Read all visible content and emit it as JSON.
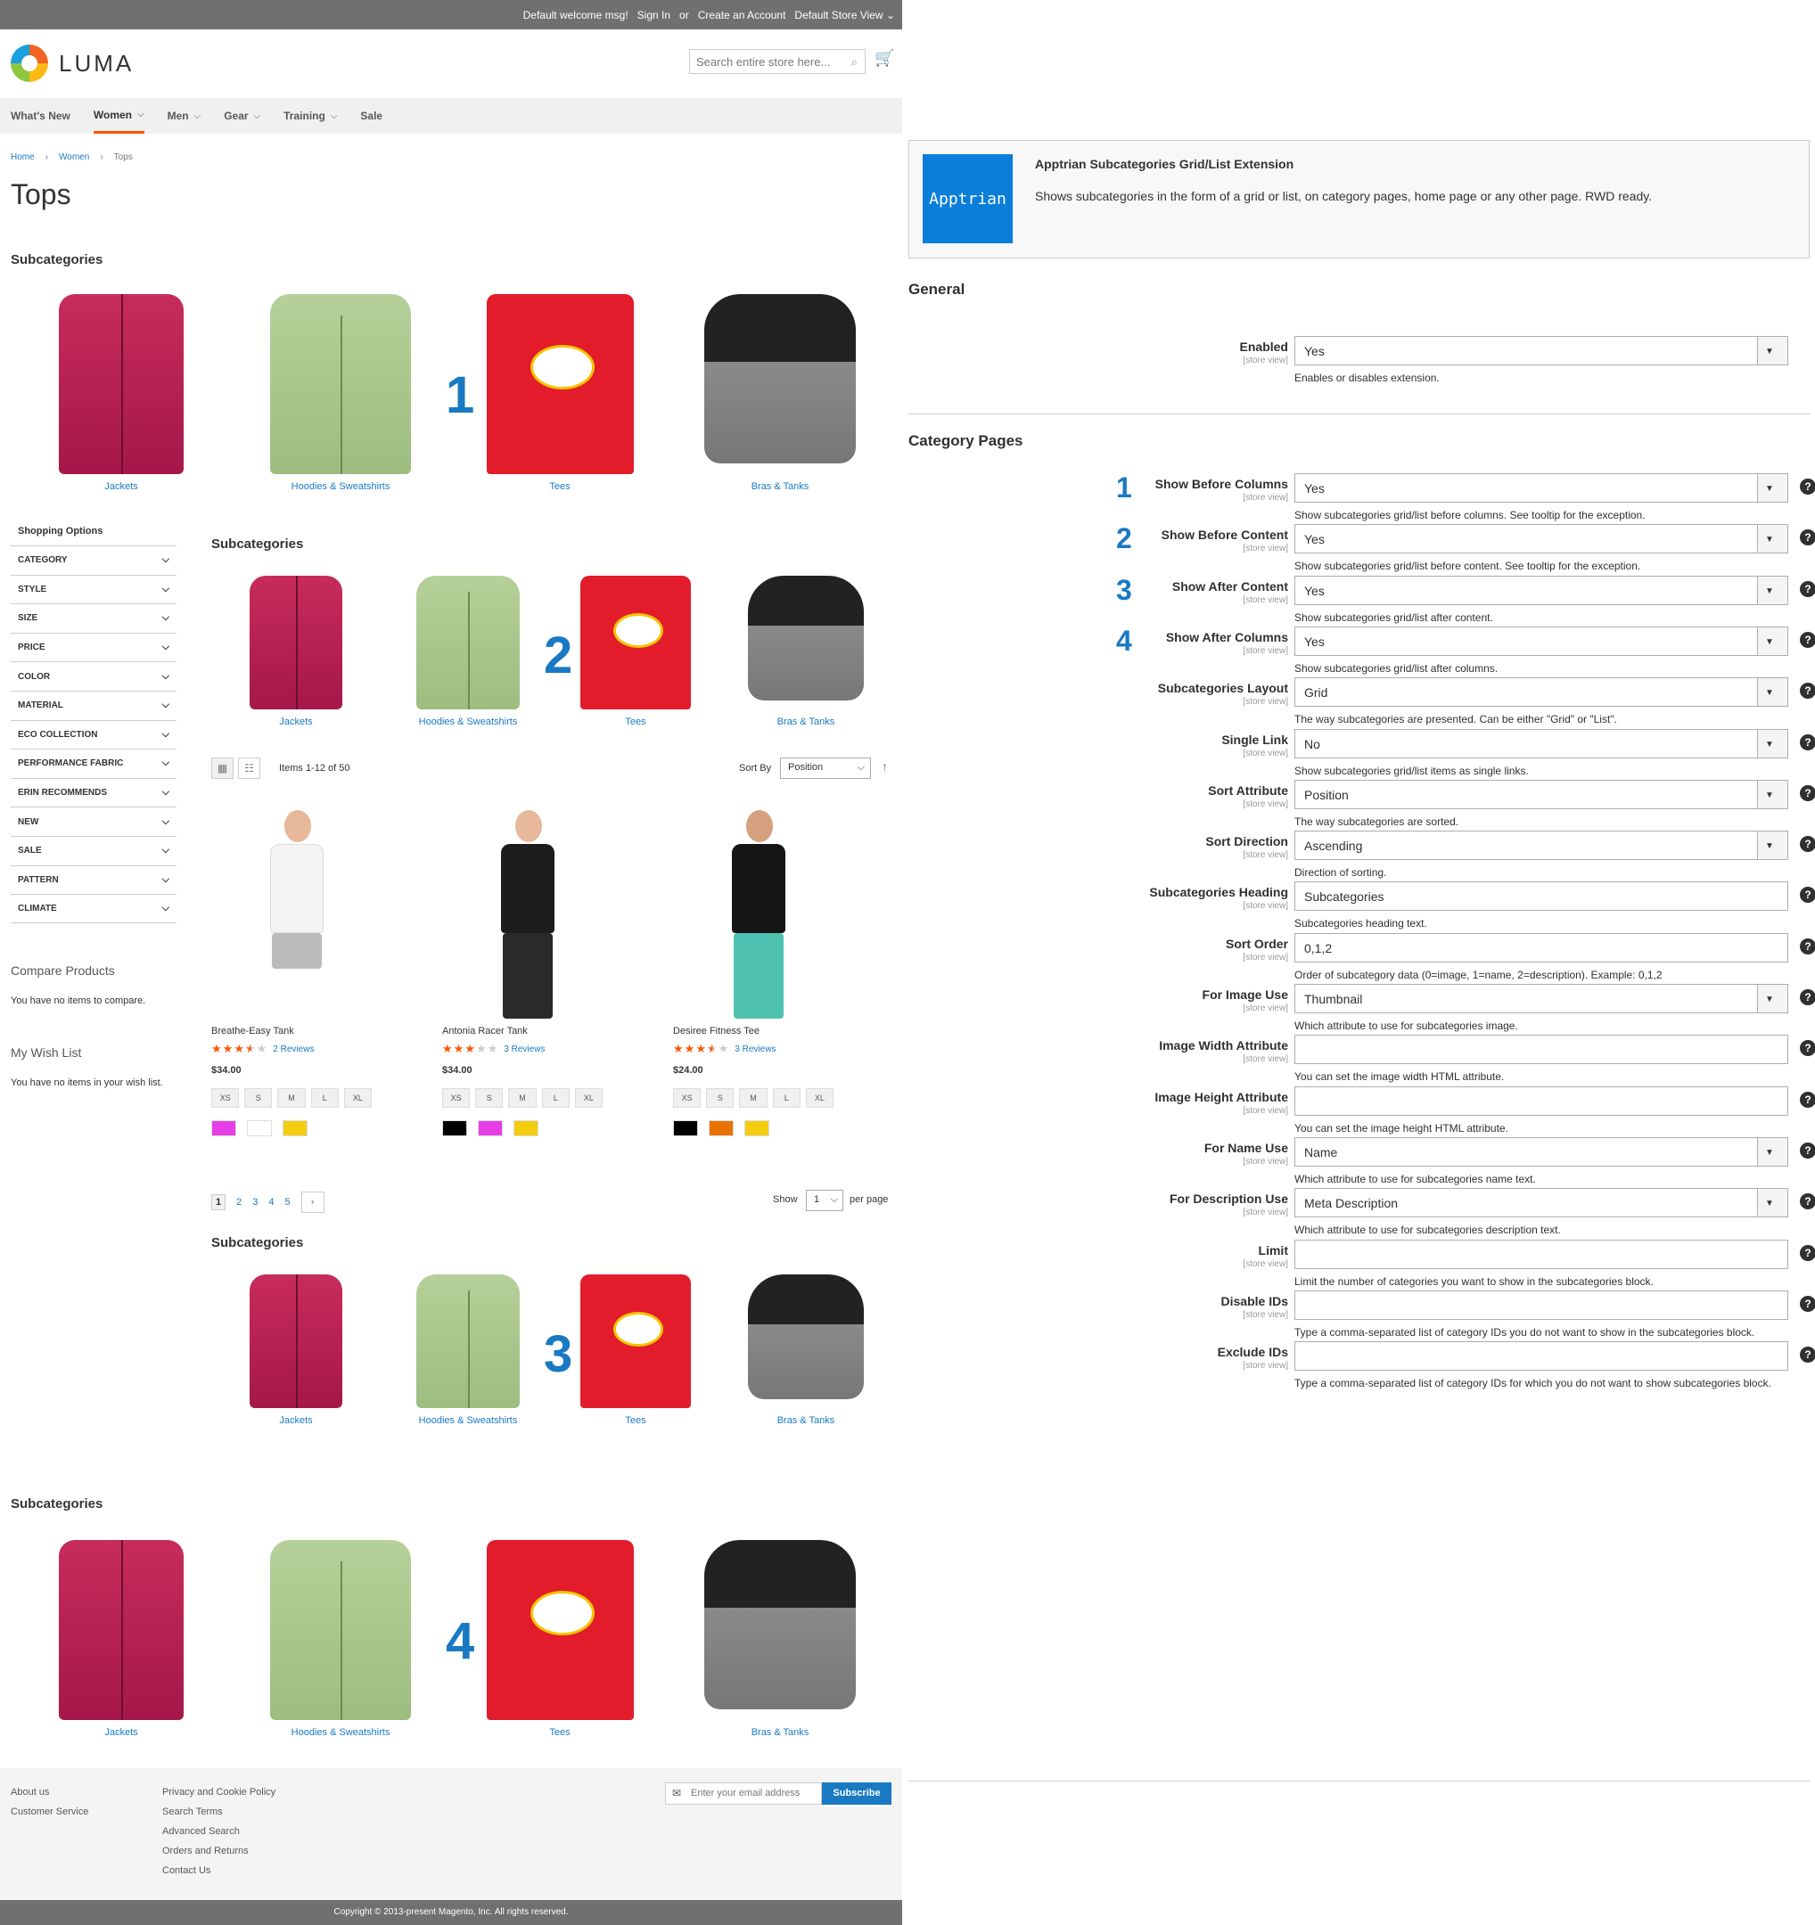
{
  "store": {
    "topbar": {
      "welcome": "Default welcome msg!",
      "sign_in": "Sign In",
      "or": "or",
      "create": "Create an Account",
      "store_view": "Default Store View"
    },
    "logo_text": "LUMA",
    "search_placeholder": "Search entire store here...",
    "nav": [
      "What's New",
      "Women",
      "Men",
      "Gear",
      "Training",
      "Sale"
    ],
    "breadcrumbs": [
      "Home",
      "Women",
      "Tops"
    ],
    "page_title": "Tops",
    "subcat_heading": "Subcategories",
    "categories": [
      "Jackets",
      "Hoodies & Sweatshirts",
      "Tees",
      "Bras & Tanks"
    ],
    "markers": [
      "1",
      "2",
      "3",
      "4"
    ],
    "shopping_options": "Shopping Options",
    "filters": [
      "CATEGORY",
      "STYLE",
      "SIZE",
      "PRICE",
      "COLOR",
      "MATERIAL",
      "ECO COLLECTION",
      "PERFORMANCE FABRIC",
      "ERIN RECOMMENDS",
      "NEW",
      "SALE",
      "PATTERN",
      "CLIMATE"
    ],
    "compare_title": "Compare Products",
    "compare_text": "You have no items to compare.",
    "wishlist_title": "My Wish List",
    "wishlist_text": "You have no items in your wish list.",
    "toolbar": {
      "items": "Items 1-12 of 50",
      "sort_by": "Sort By",
      "sort_value": "Position",
      "show": "Show",
      "limit": "1",
      "per_page": "per page"
    },
    "products": [
      {
        "name": "Breathe-Easy Tank",
        "rating": 3.5,
        "stars": "★★★★★",
        "reviews": "2  Reviews",
        "price": "$34.00",
        "sizes": [
          "XS",
          "S",
          "M",
          "L",
          "XL"
        ],
        "colors": [
          "#e63ee6",
          "#ffffff",
          "#f4cc10"
        ]
      },
      {
        "name": "Antonia Racer Tank",
        "rating": 3,
        "stars": "★★★★★",
        "reviews": "3  Reviews",
        "price": "$34.00",
        "sizes": [
          "XS",
          "S",
          "M",
          "L",
          "XL"
        ],
        "colors": [
          "#000000",
          "#e63ee6",
          "#f4cc10"
        ]
      },
      {
        "name": "Desiree Fitness Tee",
        "rating": 3.5,
        "stars": "★★★★★",
        "reviews": "3  Reviews",
        "price": "$24.00",
        "sizes": [
          "XS",
          "S",
          "M",
          "L",
          "XL"
        ],
        "colors": [
          "#000000",
          "#ea7200",
          "#f4cc10"
        ]
      }
    ],
    "pages": [
      "1",
      "2",
      "3",
      "4",
      "5"
    ],
    "footer": {
      "col1": [
        "About us",
        "Customer Service"
      ],
      "col2": [
        "Privacy and Cookie Policy",
        "Search Terms",
        "Advanced Search",
        "Orders and Returns",
        "Contact Us"
      ],
      "email_placeholder": "Enter your email address",
      "subscribe": "Subscribe"
    },
    "copyright": "Copyright © 2013-present Magento, Inc. All rights reserved."
  },
  "admin": {
    "ext_logo": "Apptrian",
    "ext_title": "Apptrian Subcategories Grid/List Extension",
    "ext_desc": "Shows subcategories in the form of a grid or list, on category pages, home page or any other page. RWD ready.",
    "section_general": "General",
    "section_category": "Category Pages",
    "scope": "[store view]",
    "enabled": {
      "label": "Enabled",
      "value": "Yes",
      "hint": "Enables or disables extension."
    },
    "fields": [
      {
        "num": "1",
        "label": "Show Before Columns",
        "value": "Yes",
        "type": "select",
        "hint": "Show subcategories grid/list before columns. See tooltip for the exception."
      },
      {
        "num": "2",
        "label": "Show Before Content",
        "value": "Yes",
        "type": "select",
        "hint": "Show subcategories grid/list before content. See tooltip for the exception."
      },
      {
        "num": "3",
        "label": "Show After Content",
        "value": "Yes",
        "type": "select",
        "hint": "Show subcategories grid/list after content."
      },
      {
        "num": "4",
        "label": "Show After Columns",
        "value": "Yes",
        "type": "select",
        "hint": "Show subcategories grid/list after columns."
      },
      {
        "num": "",
        "label": "Subcategories Layout",
        "value": "Grid",
        "type": "select",
        "hint": "The way subcategories are presented. Can be either \"Grid\" or \"List\"."
      },
      {
        "num": "",
        "label": "Single Link",
        "value": "No",
        "type": "select",
        "hint": "Show subcategories grid/list items as single links."
      },
      {
        "num": "",
        "label": "Sort Attribute",
        "value": "Position",
        "type": "select",
        "hint": "The way subcategories are sorted."
      },
      {
        "num": "",
        "label": "Sort Direction",
        "value": "Ascending",
        "type": "select",
        "hint": "Direction of sorting."
      },
      {
        "num": "",
        "label": "Subcategories Heading",
        "value": "Subcategories",
        "type": "text",
        "hint": "Subcategories heading text."
      },
      {
        "num": "",
        "label": "Sort Order",
        "value": "0,1,2",
        "type": "text",
        "hint": "Order of subcategory data (0=image, 1=name, 2=description). Example: 0,1,2"
      },
      {
        "num": "",
        "label": "For Image Use",
        "value": "Thumbnail",
        "type": "select",
        "hint": "Which attribute to use for subcategories image."
      },
      {
        "num": "",
        "label": "Image Width Attribute",
        "value": "",
        "type": "text",
        "hint": "You can set the image width HTML attribute."
      },
      {
        "num": "",
        "label": "Image Height Attribute",
        "value": "",
        "type": "text",
        "hint": "You can set the image height HTML attribute."
      },
      {
        "num": "",
        "label": "For Name Use",
        "value": "Name",
        "type": "select",
        "hint": "Which attribute to use for subcategories name text."
      },
      {
        "num": "",
        "label": "For Description Use",
        "value": "Meta Description",
        "type": "select",
        "hint": "Which attribute to use for subcategories description text."
      },
      {
        "num": "",
        "label": "Limit",
        "value": "",
        "type": "text",
        "hint": "Limit the number of categories you want to show in the subcategories block."
      },
      {
        "num": "",
        "label": "Disable IDs",
        "value": "",
        "type": "text",
        "hint": "Type a comma-separated list of category IDs you do not want to show in the subcategories block."
      },
      {
        "num": "",
        "label": "Exclude IDs",
        "value": "",
        "type": "text",
        "hint": "Type a comma-separated list of category IDs for which you do not want to show subcategories block."
      }
    ]
  }
}
